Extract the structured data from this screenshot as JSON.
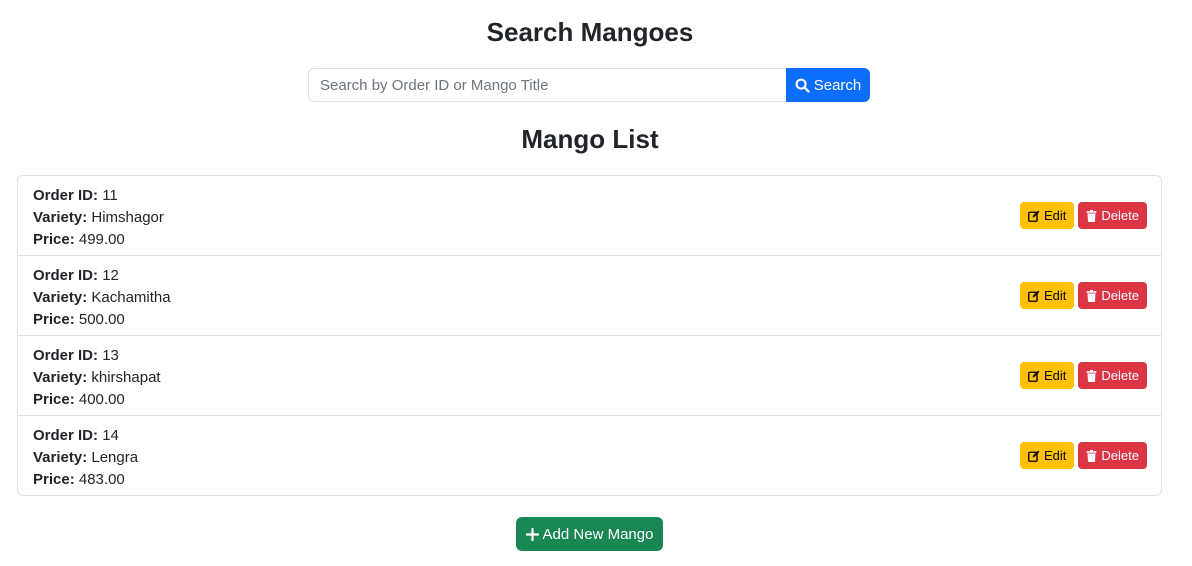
{
  "search": {
    "title": "Search Mangoes",
    "placeholder": "Search by Order ID or Mango Title",
    "value": "",
    "button_label": "Search",
    "button_icon": "search-icon"
  },
  "list": {
    "title": "Mango List",
    "labels": {
      "order_id": "Order ID:",
      "variety": "Variety:",
      "price": "Price:"
    },
    "edit_label": "Edit",
    "delete_label": "Delete",
    "items": [
      {
        "order_id": "11",
        "variety": "Himshagor",
        "price": "499.00"
      },
      {
        "order_id": "12",
        "variety": "Kachamitha",
        "price": "500.00"
      },
      {
        "order_id": "13",
        "variety": "khirshapat",
        "price": "400.00"
      },
      {
        "order_id": "14",
        "variety": "Lengra",
        "price": "483.00"
      }
    ]
  },
  "add_button": {
    "label": "Add New Mango",
    "icon": "plus-icon"
  },
  "colors": {
    "primary": "#0d6efd",
    "warning": "#ffc107",
    "danger": "#dc3545",
    "success": "#198754"
  }
}
